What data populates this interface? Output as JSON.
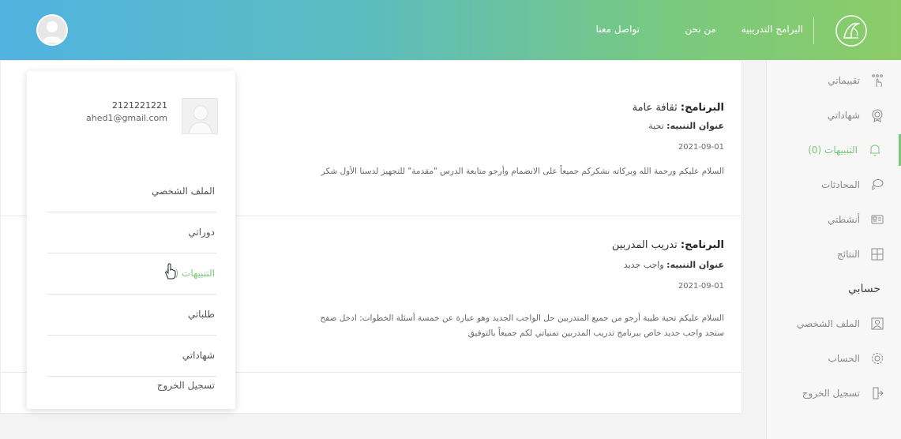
{
  "header": {
    "nav": {
      "programs": "البرامج التدريبية",
      "about": "من نحن",
      "contact": "تواصل معنا"
    }
  },
  "sidebar": {
    "items": [
      {
        "label": "تقييماتي",
        "icon": "hand-pointer-icon"
      },
      {
        "label": "شهاداتي",
        "icon": "certificate-icon"
      },
      {
        "label": "التنبيهات (0)",
        "icon": "bell-icon"
      },
      {
        "label": "المحادثات",
        "icon": "chat-icon"
      },
      {
        "label": "أنشطتي",
        "icon": "activity-icon"
      },
      {
        "label": "النتائج",
        "icon": "results-icon"
      }
    ],
    "account_heading": "حسابي",
    "account_items": [
      {
        "label": "الملف الشخصي",
        "icon": "profile-icon"
      },
      {
        "label": "الحساب",
        "icon": "gear-icon"
      },
      {
        "label": "تسجيل الخروج",
        "icon": "logout-icon"
      }
    ]
  },
  "notices": [
    {
      "program_label": "البرنامج:",
      "program": "ثقافة عامة",
      "title_label": "عنوان التنبيه:",
      "title": "تحية",
      "date": "2021-09-01",
      "body_line1": "السلام عليكم ورحمة الله وبركاته نشكركم جميعاً على الانضمام وأرجو متابعة الدرس \"مقدمة\" للتجهيز لدسنا الأول شكر"
    },
    {
      "program_label": "البرنامج:",
      "program": "تدريب المدربين",
      "title_label": "عنوان التنبيه:",
      "title": "واجب جديد",
      "date": "2021-09-01",
      "body_line1": "السلام عليكم تحية طيبة أرجو من جميع المتدربين حل الواجب الجديد وهو عبارة عن خمسة أسئلة الخطوات: ادخل صفح",
      "body_line2": "ستجد واجب جديد خاص ببرنامج تدريب المدربين تمنياتي لكم جميعاً بالتوفيق"
    }
  ],
  "dropdown": {
    "user_name": "2121221221",
    "user_email": "ahed1@gmail.com",
    "items": [
      {
        "label": "الملف الشخصي"
      },
      {
        "label": "دوراتي"
      },
      {
        "label": "التنبيهات (0)"
      },
      {
        "label": "طلباتي"
      },
      {
        "label": "شهاداتي"
      },
      {
        "label": "تسجيل الخروج"
      }
    ]
  },
  "colors": {
    "accent_green": "#7bc87a",
    "header_gradient_start": "#51b3e0",
    "header_gradient_end": "#8ccc68"
  }
}
